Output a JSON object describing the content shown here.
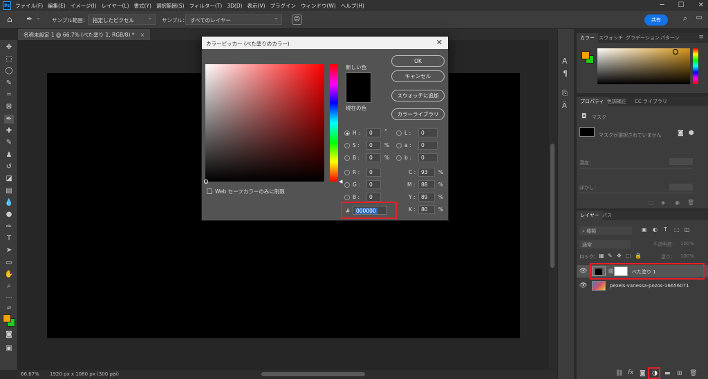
{
  "menu": {
    "items": [
      "ファイル(F)",
      "編集(E)",
      "イメージ(I)",
      "レイヤー(L)",
      "書式(Y)",
      "選択範囲(S)",
      "フィルター(T)",
      "3D(D)",
      "表示(V)",
      "プラグイン",
      "ウィンドウ(W)",
      "ヘルプ(H)"
    ]
  },
  "options": {
    "sample_size_label": "サンプル範囲：",
    "sample_size_value": "指定したピクセル",
    "sample_label": "サンプル：",
    "sample_value": "すべてのレイヤー",
    "share_label": "共有"
  },
  "document": {
    "tab_title": "名称未設定 1 @ 66.7% (べた塗り 1, RGB/8) *"
  },
  "status": {
    "zoom": "66.67%",
    "info": "1920 px x 1080 px (300 ppi)"
  },
  "picker": {
    "title": "カラーピッカー (べた塗りのカラー)",
    "new_label": "新しい色",
    "current_label": "現在の色",
    "ok": "OK",
    "cancel": "キャンセル",
    "add_swatch": "スウォッチに追加",
    "libraries": "カラーライブラリ",
    "web_only": "Web セーフカラーのみに制限",
    "H": "0",
    "S": "0",
    "B": "0",
    "R": "0",
    "G": "0",
    "Bl": "0",
    "L": "0",
    "a": "0",
    "b": "0",
    "C": "93",
    "M": "88",
    "Y": "89",
    "K": "80",
    "hex": "000000",
    "labels": {
      "H": "H :",
      "S": "S :",
      "B": "B :",
      "R": "R :",
      "G": "G :",
      "Bb": "B :",
      "L": "L :",
      "a": "a :",
      "b": "b :",
      "C": "C :",
      "M": "M :",
      "Y": "Y :",
      "K": "K :",
      "deg": "°",
      "pct": "%",
      "hash": "#"
    }
  },
  "color_panel": {
    "tabs": [
      "カラー",
      "スウォッチ",
      "グラデーション",
      "パターン"
    ],
    "fg": "#f5a000",
    "bg": "#19d219"
  },
  "properties": {
    "tabs": [
      "プロパティ",
      "色調補正",
      "CC ライブラリ"
    ],
    "mask_label": "マスク",
    "no_mask": "マスクが選択されていません",
    "density": "濃度：",
    "feather": "ぼかし："
  },
  "layers": {
    "tabs": [
      "レイヤー",
      "パス"
    ],
    "search": "種類",
    "blend": "通常",
    "opacity_label": "不透明度：",
    "opacity": "100%",
    "lock_label": "ロック：",
    "fill_label": "塗り：",
    "fill": "100%",
    "rows": [
      {
        "name": "べた塗り 1"
      },
      {
        "name": "pexels-vanessa-pozos-16656071"
      }
    ]
  },
  "toolbox": {
    "fg": "#f5a000",
    "bg": "#19d219"
  }
}
